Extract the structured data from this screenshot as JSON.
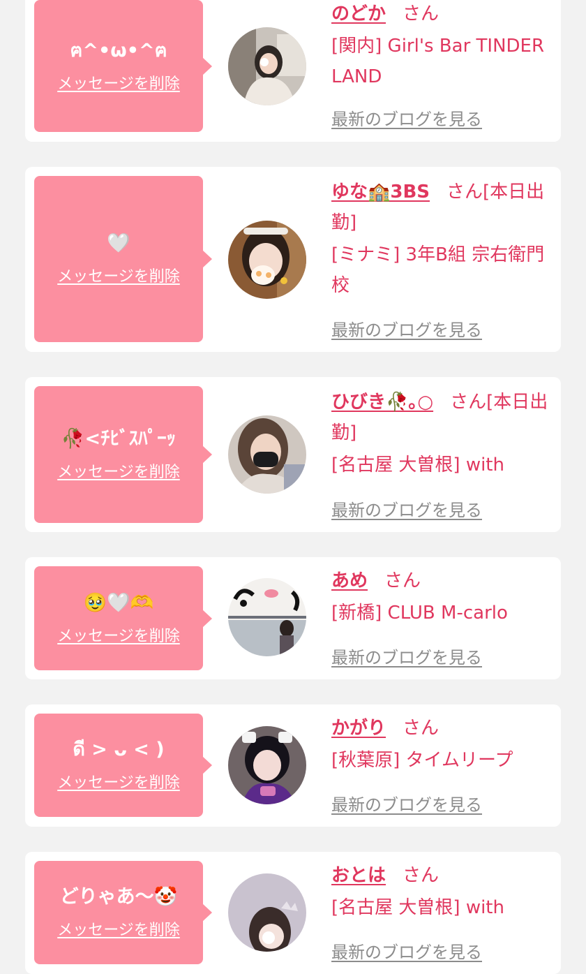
{
  "delete_label": "メッセージを削除",
  "blog_label": "最新のブログを見る",
  "san_label": "さん",
  "colors": {
    "background": "#f2f2f2",
    "card": "#ffffff",
    "bubble": "#fc8fa0",
    "accent": "#e0375e",
    "muted": "#8c8c8c"
  },
  "items": [
    {
      "message": "ฅ^•ω•^ฅ",
      "name": "のどか",
      "san": "さん",
      "status": "",
      "shop": "[関内] Girl's Bar TINDER LAND",
      "avatar": "photo-avatar"
    },
    {
      "message": "🤍",
      "name": "ゆな🏫3BS",
      "san": "さん",
      "status": "[本日出勤]",
      "shop": "[ミナミ] 3年B組 宗右衛門校",
      "avatar": "photo-avatar"
    },
    {
      "message": "🥀<ﾁﾋﾞｽﾊﾟｰｯ",
      "name": "ひびき🥀｡○",
      "san": "さん",
      "status": "[本日出勤]",
      "shop": "[名古屋 大曽根] with",
      "avatar": "photo-avatar"
    },
    {
      "message": "🥹🤍🫶",
      "name": "あめ",
      "san": "さん",
      "status": "",
      "shop": "[新橋] CLUB M-carlo",
      "avatar": "photo-avatar"
    },
    {
      "message": "ดี > ᴗ < )",
      "name": "かがり",
      "san": "さん",
      "status": "",
      "shop": "[秋葉原] タイムリープ",
      "avatar": "photo-avatar"
    },
    {
      "message": "どりゃあ〜🤡",
      "name": "おとは",
      "san": "さん",
      "status": "",
      "shop": "[名古屋 大曽根] with",
      "avatar": "photo-avatar"
    }
  ]
}
